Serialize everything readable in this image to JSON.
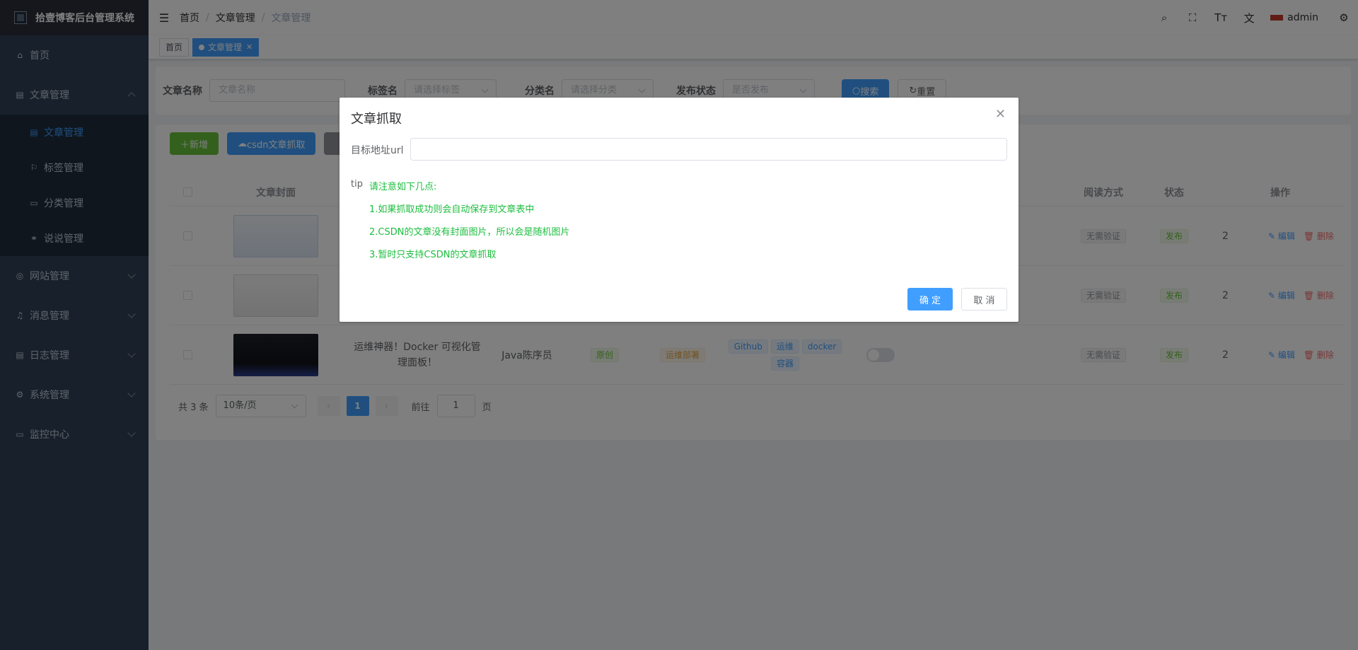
{
  "app": {
    "title": "拾壹博客后台管理系统"
  },
  "sidebar": {
    "items": [
      {
        "label": "首页"
      },
      {
        "label": "文章管理"
      },
      {
        "label": "网站管理"
      },
      {
        "label": "消息管理"
      },
      {
        "label": "日志管理"
      },
      {
        "label": "系统管理"
      },
      {
        "label": "监控中心"
      }
    ],
    "article_sub": [
      {
        "label": "文章管理"
      },
      {
        "label": "标签管理"
      },
      {
        "label": "分类管理"
      },
      {
        "label": "说说管理"
      }
    ]
  },
  "navbar": {
    "breadcrumb": [
      "首页",
      "文章管理",
      "文章管理"
    ],
    "user": "admin"
  },
  "tags": {
    "home": "首页",
    "current": "文章管理"
  },
  "search": {
    "name_label": "文章名称",
    "name_placeholder": "文章名称",
    "tag_label": "标签名",
    "tag_placeholder": "请选择标签",
    "cat_label": "分类名",
    "cat_placeholder": "请选择分类",
    "status_label": "发布状态",
    "status_placeholder": "是否发布",
    "search_btn": "搜索",
    "reset_btn": "重置"
  },
  "toolbar": {
    "add": "新增",
    "csdn": "csdn文章抓取"
  },
  "table": {
    "headers": {
      "cover": "文章封面",
      "read": "阅读方式",
      "status": "状态",
      "ops": "操作"
    },
    "rows": [
      {
        "read": "无需验证",
        "status": "发布",
        "num": "2"
      },
      {
        "read": "无需验证",
        "status": "发布",
        "num": "2"
      },
      {
        "title": "运维神器！Docker 可视化管理面板！",
        "author": "Java陈序员",
        "type": "原创",
        "category": "运维部署",
        "tags": [
          "Github",
          "运维",
          "docker",
          "容器"
        ],
        "read": "无需验证",
        "status": "发布",
        "num": "2"
      }
    ],
    "edit": "编辑",
    "del": "删除"
  },
  "pagination": {
    "total": "共 3 条",
    "size": "10条/页",
    "current": "1",
    "goto_label": "前往",
    "goto_value": "1",
    "page_suffix": "页"
  },
  "dialog": {
    "title": "文章抓取",
    "url_label": "目标地址url",
    "tip_label": "tip",
    "tips": [
      "请注意如下几点:",
      "1.如果抓取成功则会自动保存到文章表中",
      "2.CSDN的文章没有封面图片，所以会是随机图片",
      "3.暂时只支持CSDN的文章抓取"
    ],
    "ok": "确 定",
    "cancel": "取 消"
  }
}
